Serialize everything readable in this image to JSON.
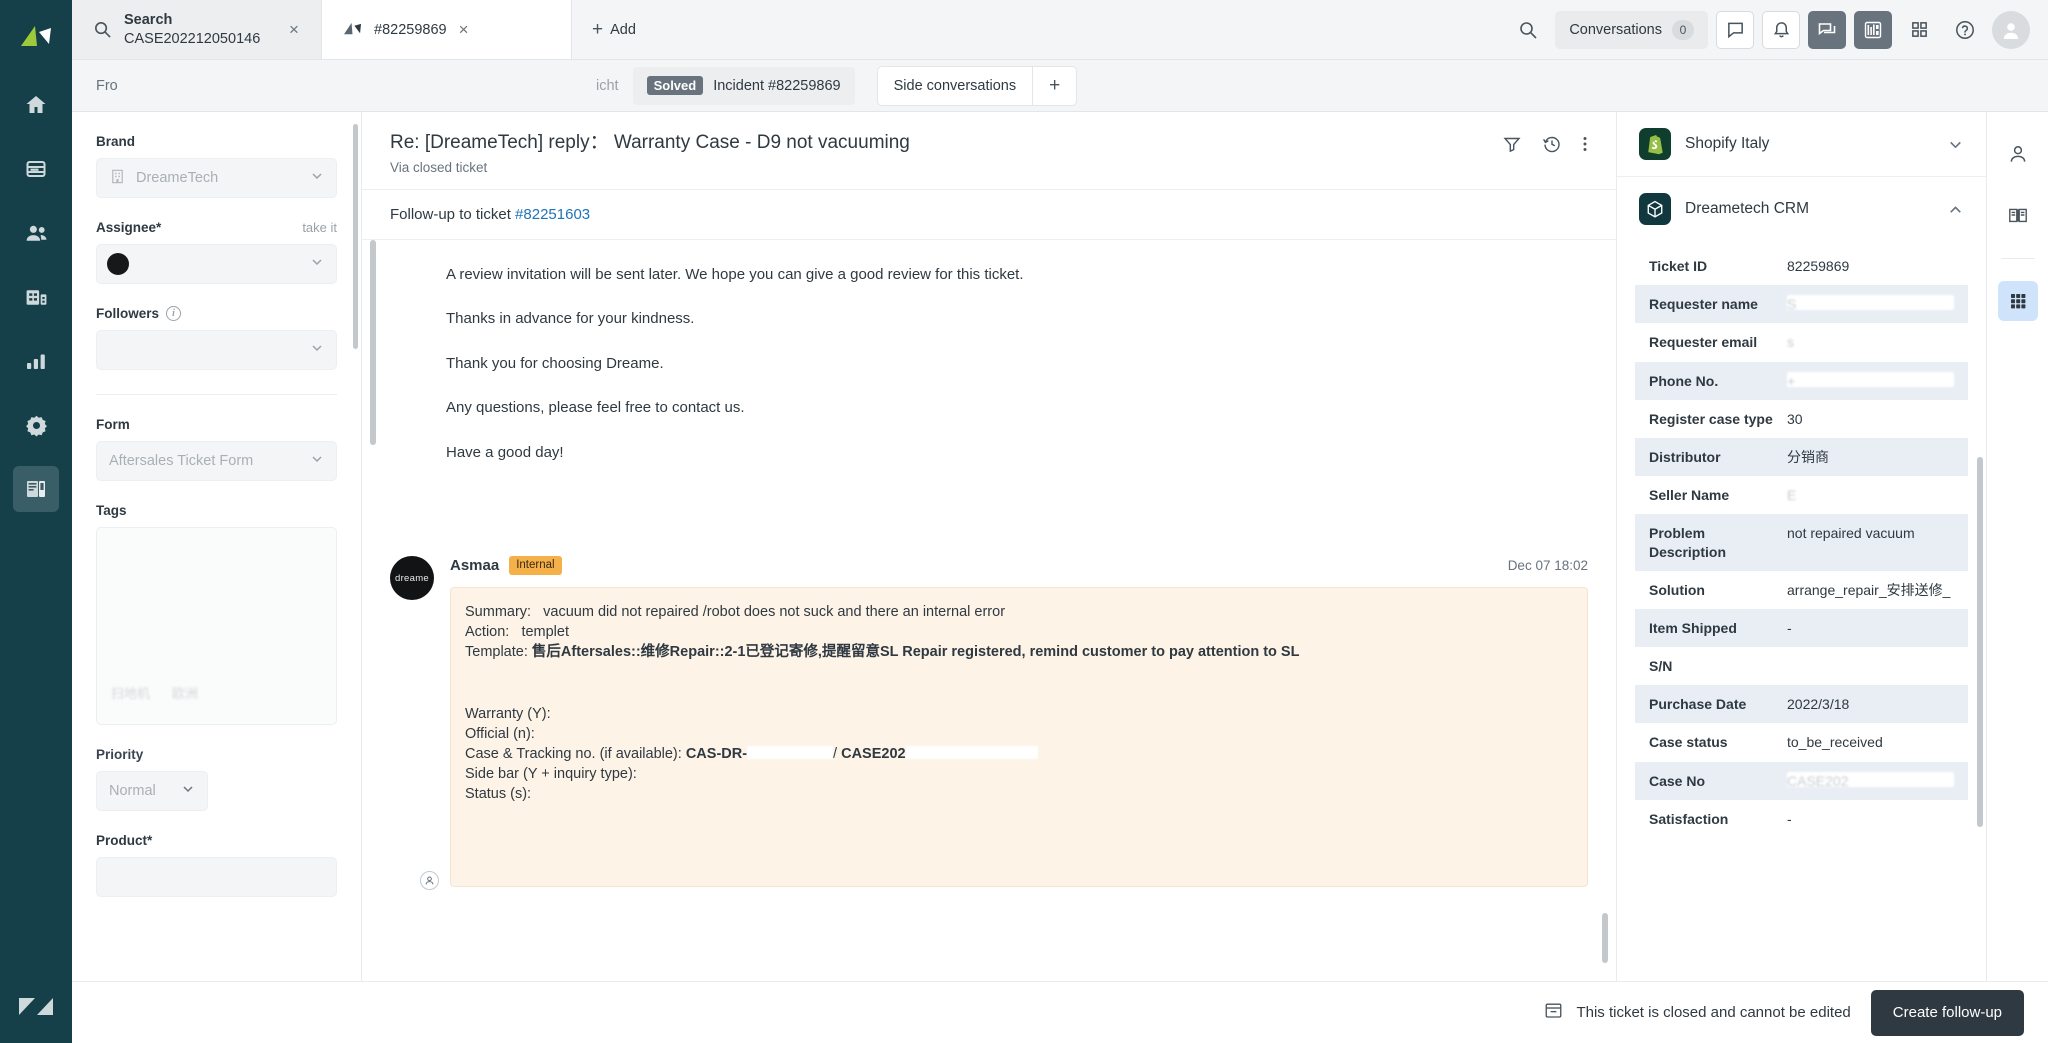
{
  "nav_rail": {
    "items": [
      {
        "name": "home",
        "icon": "home-icon"
      },
      {
        "name": "views",
        "icon": "views-icon"
      },
      {
        "name": "customers",
        "icon": "customers-icon"
      },
      {
        "name": "organizations",
        "icon": "organizations-icon"
      },
      {
        "name": "reporting",
        "icon": "reporting-icon"
      },
      {
        "name": "admin",
        "icon": "gear-icon"
      },
      {
        "name": "apps",
        "icon": "apps-icon"
      }
    ]
  },
  "topbar": {
    "tabs": [
      {
        "icon": "search-icon",
        "title": "Search",
        "subtitle": "CASE202212050146",
        "close": "×",
        "active": false
      },
      {
        "icon": "ticket-icon",
        "title": "#82259869",
        "close": "×",
        "active": true
      }
    ],
    "add_label": "Add",
    "add_plus": "+",
    "search_icon": "search-icon",
    "conversations_label": "Conversations",
    "conversations_count": "0",
    "icons": [
      {
        "name": "chat-icon",
        "style": "boxed"
      },
      {
        "name": "bell-icon",
        "style": "boxed"
      },
      {
        "name": "messaging-icon",
        "style": "selected"
      },
      {
        "name": "dashboard-icon",
        "style": "selected"
      },
      {
        "name": "grid-apps-icon",
        "style": "plain"
      },
      {
        "name": "help-icon",
        "style": "plain"
      }
    ],
    "avatar": "user-avatar"
  },
  "subjectbar": {
    "subject_value": "Fro",
    "subject_tail": "icht",
    "status_badge": "Solved",
    "status_label": "Incident #82259869",
    "side_conversations_label": "Side conversations",
    "side_conversations_plus": "+"
  },
  "properties": {
    "brand": {
      "label": "Brand",
      "value": "DreameTech",
      "icon": "building-icon"
    },
    "assignee": {
      "label": "Assignee*",
      "take_it": "take it",
      "value": ""
    },
    "followers": {
      "label": "Followers",
      "info_icon": "info-icon",
      "value": ""
    },
    "form": {
      "label": "Form",
      "value": "Aftersales Ticket Form"
    },
    "tags": {
      "label": "Tags",
      "ghost_tags": [
        "扫地机",
        "欧洲"
      ]
    },
    "priority": {
      "label": "Priority",
      "value": "Normal"
    },
    "product": {
      "label": "Product*",
      "value": ""
    }
  },
  "conversation": {
    "subject": "Re: [DreameTech] reply： Warranty Case - D9 not vacuuming",
    "via": "Via closed ticket",
    "header_icons": [
      {
        "name": "filter-icon"
      },
      {
        "name": "history-icon"
      },
      {
        "name": "more-options-icon"
      }
    ],
    "followup_prefix": "Follow-up to ticket ",
    "followup_ticket": "#82251603",
    "message_paragraphs": [
      "A review invitation will be sent later. We hope you can give a good review for this ticket.",
      "Thanks in advance for your kindness.",
      "Thank you for choosing Dreame.",
      "Any questions, please feel free to contact us.",
      "Have a good day!"
    ],
    "note": {
      "avatar_text": "dreame",
      "author": "Asmaa",
      "badge": "Internal",
      "timestamp": "Dec 07 18:02",
      "line_summary_key": "Summary:",
      "line_summary_val": "vacuum did not repaired /robot does not suck and there an internal error",
      "line_action_key": "Action:",
      "line_action_val": "templet",
      "line_template_key": "Template:",
      "line_template_val": "售后Aftersales::维修Repair::2-1已登记寄修,提醒留意SL Repair registered, remind customer to pay attention to SL",
      "warranty_line": "Warranty (Y):",
      "official_line": "Official (n):",
      "case_tracking_prefix": "Case & Tracking no. (if available): ",
      "case_tracking_bold1": "CAS-DR-",
      "case_tracking_sep": "/ ",
      "case_tracking_bold2": "CASE202",
      "sidebar_line": "Side bar (Y + inquiry type):",
      "status_line": "Status (s):"
    }
  },
  "apps": {
    "shopify": {
      "name": "Shopify Italy",
      "icon": "shopify-icon",
      "expanded": false,
      "chevron": "chevron-down-icon"
    },
    "crm": {
      "name": "Dreametech CRM",
      "icon": "cube-icon",
      "expanded": true,
      "chevron": "chevron-up-icon",
      "fields": [
        {
          "key": "Ticket ID",
          "value": "82259869",
          "masked": false,
          "alt": false
        },
        {
          "key": "Requester name",
          "value": "S",
          "masked": true,
          "alt": true
        },
        {
          "key": "Requester email",
          "value": "s",
          "masked": true,
          "alt": false
        },
        {
          "key": "Phone No.",
          "value": "+",
          "masked": true,
          "alt": true
        },
        {
          "key": "Register case type",
          "value": "30",
          "masked": false,
          "alt": false
        },
        {
          "key": "Distributor",
          "value": "分销商",
          "masked": false,
          "alt": true
        },
        {
          "key": "Seller Name",
          "value": "E",
          "masked": true,
          "alt": false
        },
        {
          "key": "Problem Description",
          "value": "not repaired vacuum",
          "masked": false,
          "alt": true
        },
        {
          "key": "Solution",
          "value": "arrange_repair_安排送修_",
          "masked": false,
          "alt": false
        },
        {
          "key": "Item Shipped",
          "value": "-",
          "masked": false,
          "alt": true
        },
        {
          "key": "S/N",
          "value": "",
          "masked": true,
          "alt": false
        },
        {
          "key": "Purchase Date",
          "value": "2022/3/18",
          "masked": false,
          "alt": true
        },
        {
          "key": "Case status",
          "value": "to_be_received",
          "masked": false,
          "alt": false
        },
        {
          "key": "Case No",
          "value": "CASE202",
          "masked": true,
          "alt": true
        },
        {
          "key": "Satisfaction",
          "value": "-",
          "masked": false,
          "alt": false
        }
      ]
    }
  },
  "right_rail": {
    "items": [
      {
        "name": "user-profile-icon",
        "active": false
      },
      {
        "name": "knowledge-book-icon",
        "active": false
      },
      {
        "name": "apps-grid-icon",
        "active": true
      }
    ]
  },
  "bottombar": {
    "closed_icon": "archive-icon",
    "closed_message": "This ticket is closed and cannot be edited",
    "followup_button": "Create follow-up"
  },
  "colors": {
    "nav_bg": "#15404a",
    "accent_link": "#1f73b7",
    "internal_badge": "#f5b04a",
    "note_bg": "#fdf3e7",
    "crm_alt_row": "#e9eef5",
    "button_dark": "#2f3941",
    "rail_active": "#cfe3fb"
  }
}
